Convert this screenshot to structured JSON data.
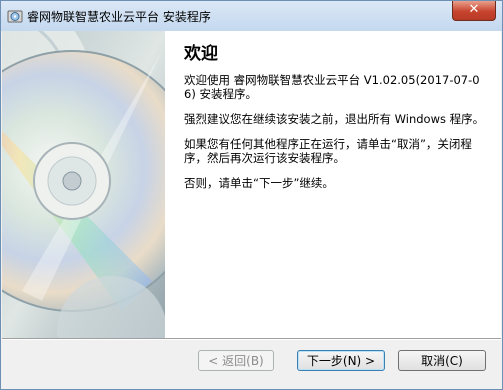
{
  "window": {
    "title": "睿网物联智慧农业云平台 安装程序",
    "close_label": "✕"
  },
  "main": {
    "heading": "欢迎",
    "paragraphs": [
      "欢迎使用 睿网物联智慧农业云平台 V1.02.05(2017-07-06) 安装程序。",
      "强烈建议您在继续该安装之前，退出所有 Windows 程序。",
      "如果您有任何其他程序正在运行，请单击“取消”，关闭程序，然后再次运行该安装程序。",
      "否则，请单击“下一步”继续。"
    ]
  },
  "buttons": {
    "back": "< 返回(B)",
    "next": "下一步(N) >",
    "cancel": "取消(C)"
  },
  "colors": {
    "titlebar": "#c4d8ef",
    "close_button": "#c7442e",
    "content_background": "#ffffff",
    "default_button_border": "#3c7fb1"
  },
  "icons": [
    "installer-app-icon",
    "close-icon",
    "cd-disc-illustration"
  ]
}
